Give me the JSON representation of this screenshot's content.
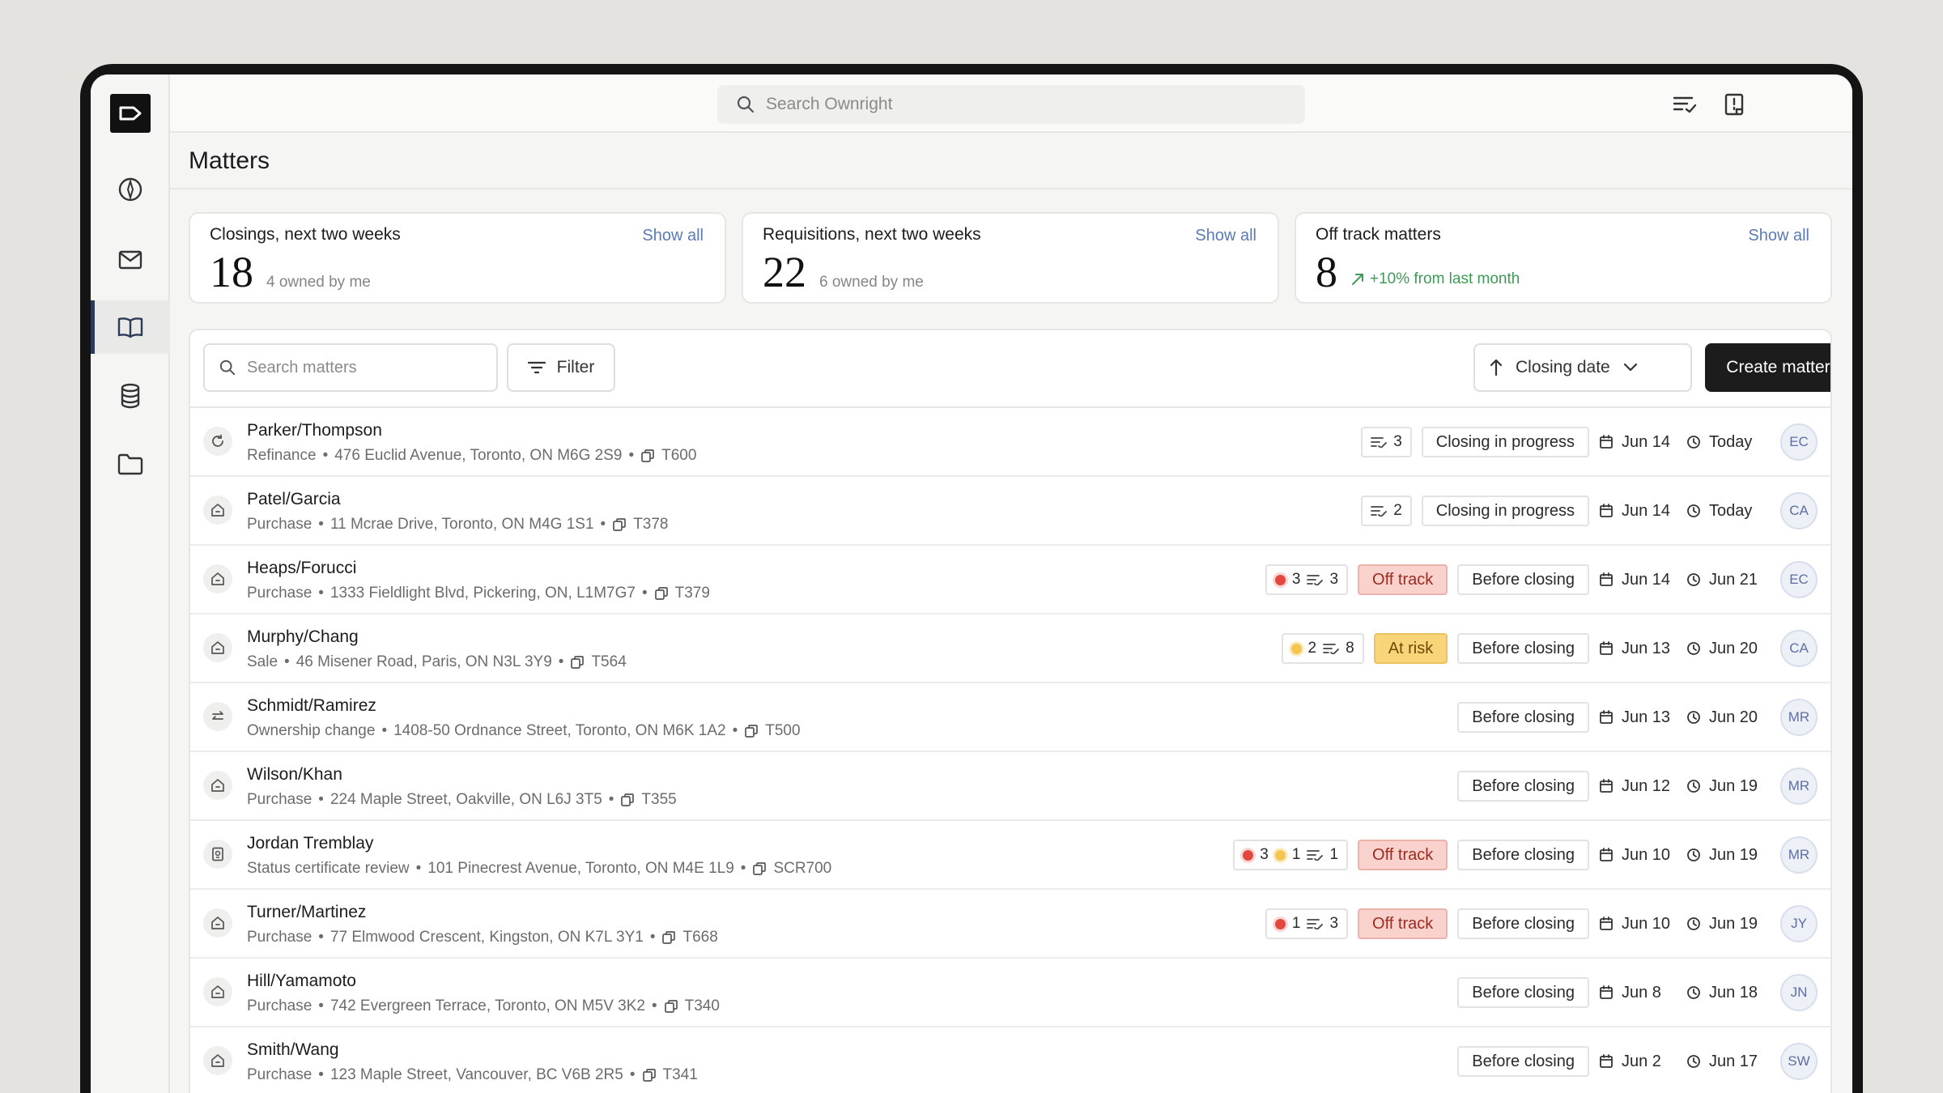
{
  "search": {
    "placeholder": "Search Ownright"
  },
  "page": {
    "title": "Matters"
  },
  "stats": [
    {
      "label": "Closings, next two weeks",
      "show_all": "Show all",
      "value": "18",
      "sub": "4 owned by me"
    },
    {
      "label": "Requisitions, next two weeks",
      "show_all": "Show all",
      "value": "22",
      "sub": "6 owned by me"
    },
    {
      "label": "Off track matters",
      "show_all": "Show all",
      "value": "8",
      "trend": "+10% from last month"
    }
  ],
  "toolbar": {
    "search_placeholder": "Search matters",
    "filter_label": "Filter",
    "sort_label": "Closing date",
    "create_label": "Create matter"
  },
  "matters": [
    {
      "icon": "refinance-icon",
      "name": "Parker/Thompson",
      "type": "Refinance",
      "address": "476 Euclid Avenue, Toronto, ON M6G 2S9",
      "code": "T600",
      "red": "",
      "yellow": "",
      "tasks": "3",
      "risk": "",
      "stage": "Closing in progress",
      "date1": "Jun 14",
      "date2": "Today",
      "owner": "EC"
    },
    {
      "icon": "house-icon",
      "name": "Patel/Garcia",
      "type": "Purchase",
      "address": "11 Mcrae Drive, Toronto, ON M4G 1S1",
      "code": "T378",
      "red": "",
      "yellow": "",
      "tasks": "2",
      "risk": "",
      "stage": "Closing in progress",
      "date1": "Jun 14",
      "date2": "Today",
      "owner": "CA"
    },
    {
      "icon": "house-icon",
      "name": "Heaps/Forucci",
      "type": "Purchase",
      "address": "1333 Fieldlight Blvd, Pickering, ON, L1M7G7",
      "code": "T379",
      "red": "3",
      "yellow": "",
      "tasks": "3",
      "risk": "Off track",
      "stage": "Before closing",
      "date1": "Jun 14",
      "date2": "Jun 21",
      "owner": "EC"
    },
    {
      "icon": "house-icon",
      "name": "Murphy/Chang",
      "type": "Sale",
      "address": "46 Misener Road, Paris, ON N3L 3Y9",
      "code": "T564",
      "red": "",
      "yellow": "2",
      "tasks": "8",
      "risk": "At risk",
      "stage": "Before closing",
      "date1": "Jun 13",
      "date2": "Jun 20",
      "owner": "CA"
    },
    {
      "icon": "ownership-change-icon",
      "name": "Schmidt/Ramirez",
      "type": "Ownership change",
      "address": "1408-50 Ordnance Street, Toronto, ON M6K 1A2",
      "code": "T500",
      "red": "",
      "yellow": "",
      "tasks": "",
      "risk": "",
      "stage": "Before closing",
      "date1": "Jun 13",
      "date2": "Jun 20",
      "owner": "MR"
    },
    {
      "icon": "house-icon",
      "name": "Wilson/Khan",
      "type": "Purchase",
      "address": "224 Maple Street, Oakville, ON L6J 3T5",
      "code": "T355",
      "red": "",
      "yellow": "",
      "tasks": "",
      "risk": "",
      "stage": "Before closing",
      "date1": "Jun 12",
      "date2": "Jun 19",
      "owner": "MR"
    },
    {
      "icon": "certificate-icon",
      "name": "Jordan Tremblay",
      "type": "Status certificate review",
      "address": "101 Pinecrest Avenue, Toronto, ON M4E 1L9",
      "code": "SCR700",
      "red": "3",
      "yellow": "1",
      "tasks": "1",
      "risk": "Off track",
      "stage": "Before closing",
      "date1": "Jun 10",
      "date2": "Jun 19",
      "owner": "MR"
    },
    {
      "icon": "house-icon",
      "name": "Turner/Martinez",
      "type": "Purchase",
      "address": "77 Elmwood Crescent, Kingston, ON K7L 3Y1",
      "code": "T668",
      "red": "1",
      "yellow": "",
      "tasks": "3",
      "risk": "Off track",
      "stage": "Before closing",
      "date1": "Jun 10",
      "date2": "Jun 19",
      "owner": "JY"
    },
    {
      "icon": "house-icon",
      "name": "Hill/Yamamoto",
      "type": "Purchase",
      "address": "742 Evergreen Terrace, Toronto, ON M5V 3K2",
      "code": "T340",
      "red": "",
      "yellow": "",
      "tasks": "",
      "risk": "",
      "stage": "Before closing",
      "date1": "Jun 8",
      "date2": "Jun 18",
      "owner": "JN"
    },
    {
      "icon": "house-icon",
      "name": "Smith/Wang",
      "type": "Purchase",
      "address": "123 Maple Street, Vancouver, BC V6B 2R5",
      "code": "T341",
      "red": "",
      "yellow": "",
      "tasks": "",
      "risk": "",
      "stage": "Before closing",
      "date1": "Jun 2",
      "date2": "Jun 17",
      "owner": "SW"
    }
  ],
  "colors": {
    "accent": "#5a7bb5",
    "danger": "#e2483d",
    "warning": "#f4c64f",
    "positive": "#3f9a55",
    "primary_button": "#1c1c1c"
  }
}
